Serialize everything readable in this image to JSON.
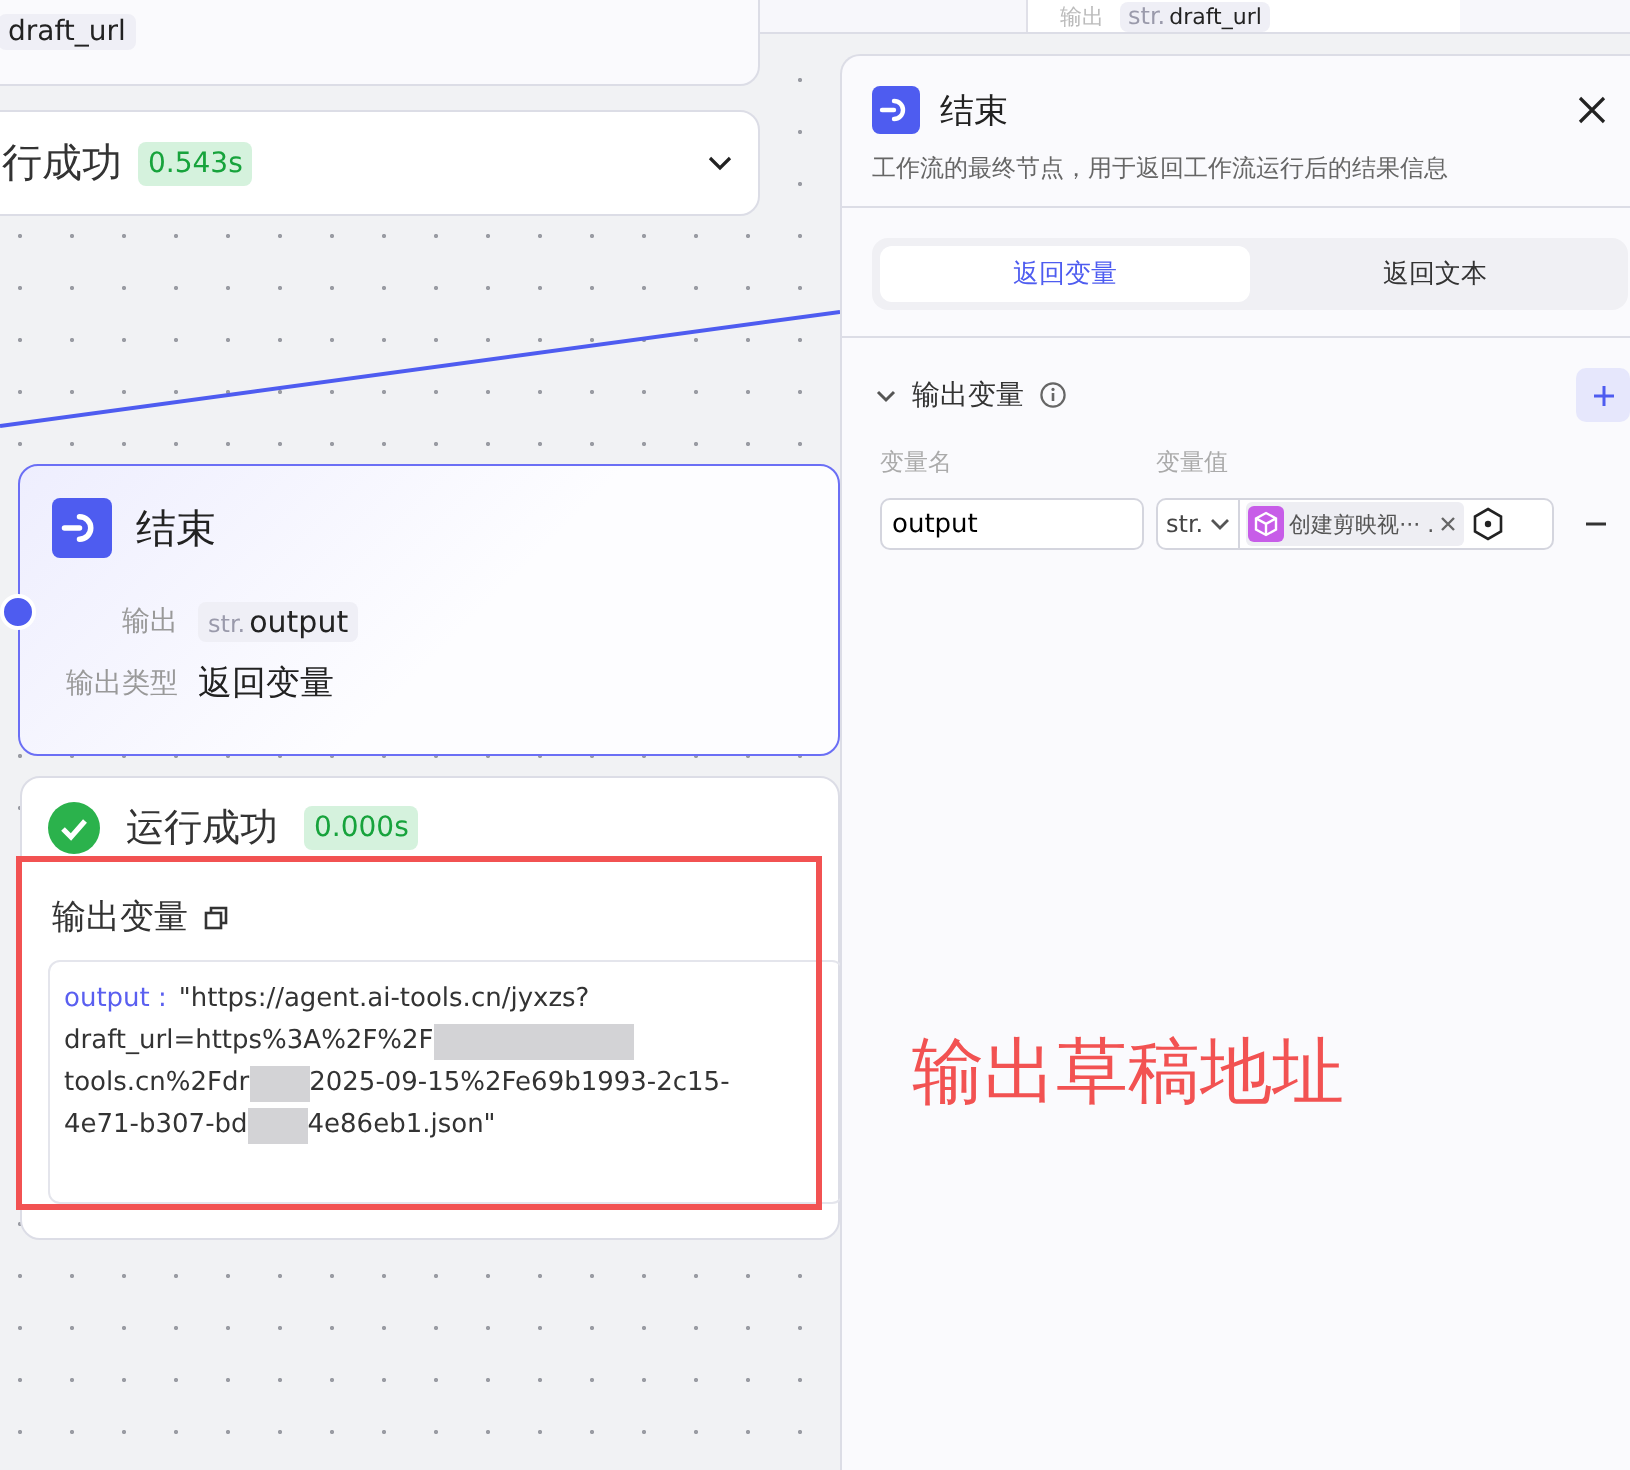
{
  "canvas": {
    "top_node": {
      "output_value": "draft_url"
    },
    "collapsed_result": {
      "status": "行成功",
      "time": "0.543s",
      "expanded": false
    },
    "end_node": {
      "title": "结束",
      "output_label": "输出",
      "output_type": "str.",
      "output_name": "output",
      "type_label": "输出类型",
      "type_value": "返回变量"
    },
    "run_result": {
      "success": true,
      "status": "运行成功",
      "time": "0.000s",
      "section_title": "输出变量",
      "output_key": "output :",
      "lines": [
        [
          "\"https://agent.ai-tools.cn/jyxzs?"
        ],
        [
          "draft_url=https%3A%2F%2F"
        ],
        [
          "tools.cn%2Fdr",
          "2025-09-15%2Fe69b1993-2c15-"
        ],
        [
          "4e71-b307-bd",
          "4e86eb1.json\""
        ]
      ]
    },
    "annotation": "输出草稿地址",
    "background_node": {
      "output_label": "输出",
      "output_type": "str.",
      "output_name": "draft_url"
    }
  },
  "panel": {
    "title": "结束",
    "description": "工作流的最终节点，用于返回工作流运行后的结果信息",
    "tabs": [
      {
        "label": "返回变量",
        "selected": true
      },
      {
        "label": "返回文本",
        "selected": false
      }
    ],
    "section": {
      "title": "输出变量",
      "expanded": true
    },
    "columns": [
      "变量名",
      "变量值"
    ],
    "variables": [
      {
        "name": "output",
        "type": "str.",
        "reference": "创建剪映视··· ."
      }
    ]
  }
}
